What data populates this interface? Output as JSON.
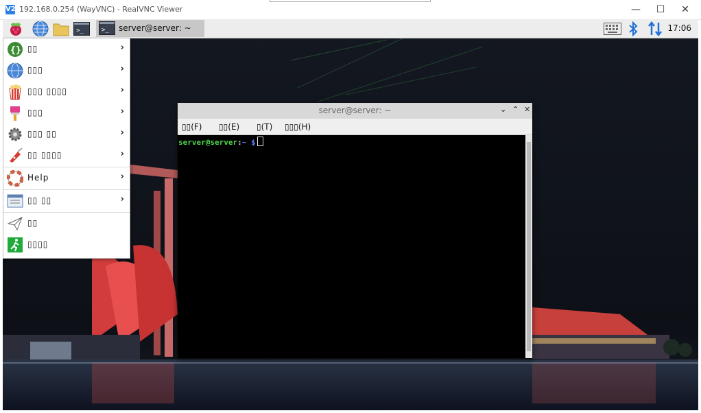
{
  "vnc": {
    "title": "192.168.0.254 (WayVNC) - RealVNC Viewer",
    "app_icon": "V2",
    "controls": {
      "minimize": "—",
      "maximize": "☐",
      "close": "✕"
    }
  },
  "taskbar": {
    "raspberry_icon": "raspberry-icon",
    "active_task": "server@server: ~",
    "clock": "17:06"
  },
  "menu": {
    "items": [
      {
        "label": "▯▯",
        "icon": "code-braces-icon",
        "submenu": true
      },
      {
        "label": "▯▯▯",
        "icon": "globe-icon",
        "submenu": true
      },
      {
        "label": "▯▯▯ ▯▯▯▯",
        "icon": "popcorn-icon",
        "submenu": true
      },
      {
        "label": "▯▯▯",
        "icon": "paintbrush-icon",
        "submenu": true
      },
      {
        "label": "▯▯▯ ▯▯",
        "icon": "gear-icon",
        "submenu": true
      },
      {
        "label": "▯▯ ▯▯▯▯",
        "icon": "swiss-knife-icon",
        "submenu": true
      },
      {
        "label": "Help",
        "icon": "lifebuoy-icon",
        "submenu": true
      },
      {
        "label": "▯▯ ▯▯",
        "icon": "preferences-icon",
        "submenu": true
      },
      {
        "label": "▯▯",
        "icon": "paper-plane-icon",
        "submenu": false
      },
      {
        "label": "▯▯▯▯",
        "icon": "logout-icon",
        "submenu": false
      }
    ]
  },
  "terminal": {
    "title": "server@server: ~",
    "menus": [
      "▯▯(F)",
      "▯▯(E)",
      "▯(T)",
      "▯▯▯(H)"
    ],
    "prompt_user": "server@server",
    "prompt_sep": ":",
    "prompt_path": "~",
    "prompt_symbol": "$",
    "colors": {
      "user": "#4fd94f",
      "path": "#5b7cff"
    }
  }
}
